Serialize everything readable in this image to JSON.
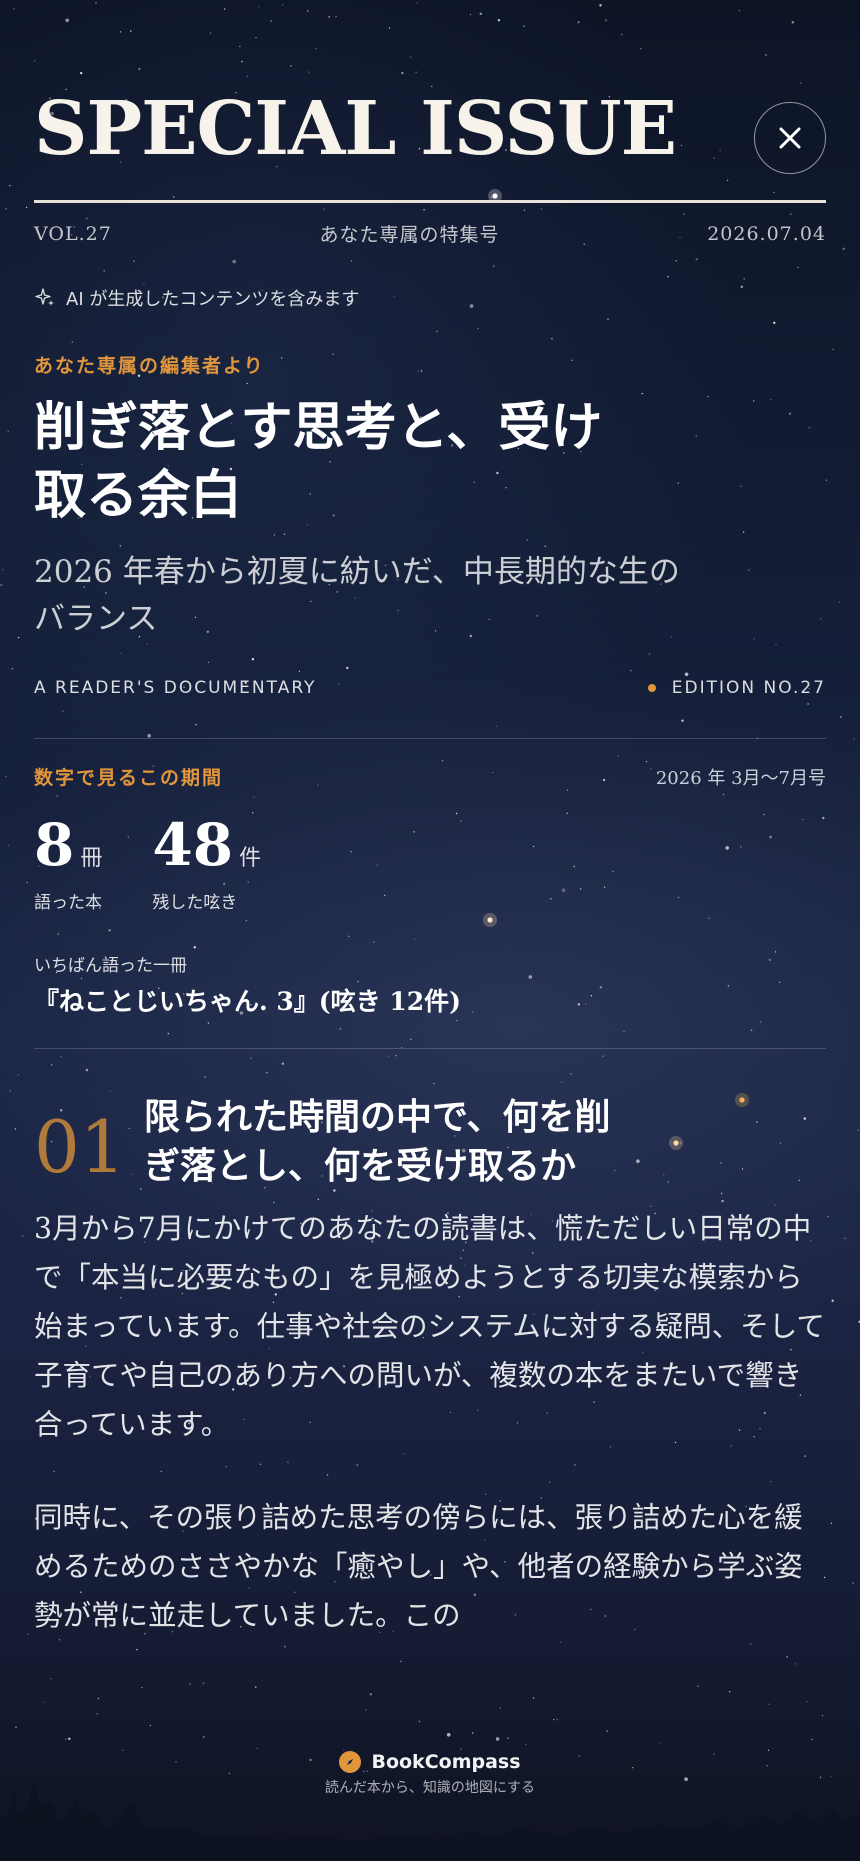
{
  "masthead": {
    "title": "SPECIAL ISSUE",
    "vol": "VOL.27",
    "tagline": "あなた専属の特集号",
    "date": "2026.07.04",
    "close_icon": "close-icon"
  },
  "ai_note": {
    "icon": "sparkle-icon",
    "text": "AI が生成したコンテンツを含みます"
  },
  "feature": {
    "eyebrow": "あなた専属の編集者より",
    "headline_line1": "削ぎ落とす思考と、受け",
    "headline_line2": "取る余白",
    "subhead_line1": "2026 年春から初夏に紡いだ、中長期的な生の",
    "subhead_line2": "バランス",
    "byline": "A READER'S DOCUMENTARY",
    "edition": "EDITION NO.27"
  },
  "stats": {
    "title": "数字で見るこの期間",
    "range": "2026 年 3月〜7月号",
    "items": [
      {
        "value": "8",
        "unit": "冊",
        "label": "語った本"
      },
      {
        "value": "48",
        "unit": "件",
        "label": "残した呟き"
      }
    ],
    "most_label": "いちばん語った一冊",
    "most_title": "『ねことじいちゃん. 3』(呟き 12件)"
  },
  "chapter": {
    "number": "01",
    "title_line1": "限られた時間の中で、何を削",
    "title_line2": "ぎ落とし、何を受け取るか",
    "paragraph1": "3月から7月にかけてのあなたの読書は、慌ただしい日常の中で「本当に必要なもの」を見極めようとする切実な模索から始まっています。仕事や社会のシステムに対する疑問、そして子育てや自己のあり方への問いが、複数の本をまたいで響き合っています。",
    "paragraph2": "同時に、その張り詰めた思考の傍らには、張り詰めた心を緩めるためのささやかな「癒やし」や、他者の経験から学ぶ姿勢が常に並走していました。この"
  },
  "brand": {
    "name": "BookCompass",
    "tagline": "読んだ本から、知識の地図にする",
    "logo_icon": "compass-icon"
  },
  "colors": {
    "accent": "#e1963c",
    "chapter_number": "#b07a3a",
    "background": "#131d35"
  }
}
